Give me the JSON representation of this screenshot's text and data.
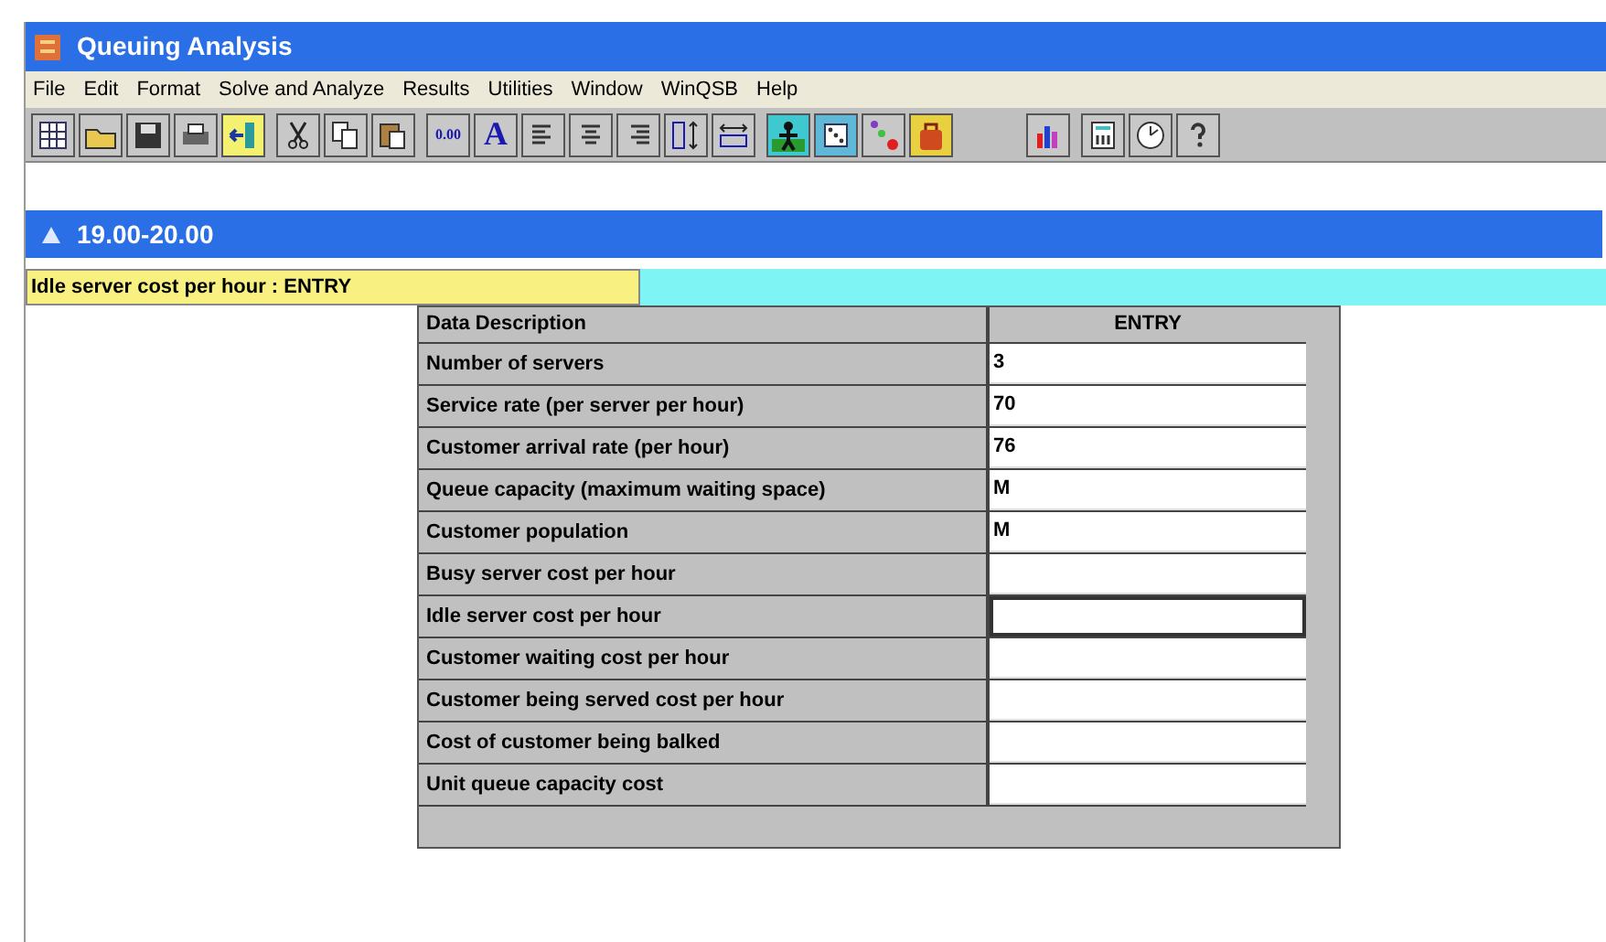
{
  "window": {
    "title": "Queuing Analysis"
  },
  "menu": [
    "File",
    "Edit",
    "Format",
    "Solve and Analyze",
    "Results",
    "Utilities",
    "Window",
    "WinQSB",
    "Help"
  ],
  "toolbar_texts": [
    "0.00",
    "A"
  ],
  "child_window": {
    "title": "19.00-20.00"
  },
  "status": {
    "text": "Idle server cost per hour : ENTRY"
  },
  "table": {
    "columns": [
      "Data Description",
      "ENTRY"
    ],
    "rows": [
      {
        "label": "Number of servers",
        "value": "3",
        "selected": false
      },
      {
        "label": "Service rate (per server per hour)",
        "value": "70",
        "selected": false
      },
      {
        "label": "Customer arrival rate (per hour)",
        "value": "76",
        "selected": false
      },
      {
        "label": "Queue capacity (maximum waiting space)",
        "value": "M",
        "selected": false
      },
      {
        "label": "Customer population",
        "value": "M",
        "selected": false
      },
      {
        "label": "Busy server cost per hour",
        "selected": false
      },
      {
        "label": "Idle server cost per hour",
        "selected": true
      },
      {
        "label": "Customer waiting cost per hour",
        "selected": false
      },
      {
        "label": "Customer being served cost per hour",
        "selected": false
      },
      {
        "label": "Cost of customer being balked",
        "selected": false
      },
      {
        "label": "Unit queue capacity cost",
        "selected": false
      }
    ]
  }
}
